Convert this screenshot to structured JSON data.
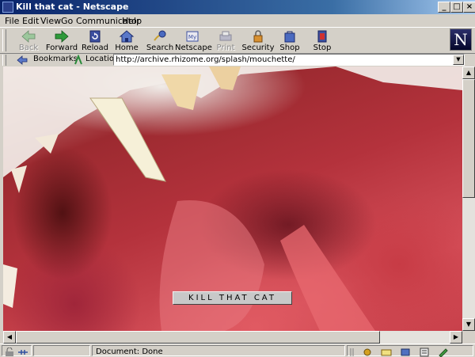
{
  "window": {
    "title": "Kill that cat - Netscape"
  },
  "menu": {
    "items": [
      "File",
      "Edit",
      "View",
      "Go",
      "Communicator",
      "Help"
    ]
  },
  "toolbar": {
    "buttons": [
      {
        "label": "Back",
        "icon": "back-arrow-icon",
        "enabled": false
      },
      {
        "label": "Forward",
        "icon": "forward-arrow-icon",
        "enabled": true
      },
      {
        "label": "Reload",
        "icon": "reload-icon",
        "enabled": true
      },
      {
        "label": "Home",
        "icon": "home-icon",
        "enabled": true
      },
      {
        "label": "Search",
        "icon": "search-icon",
        "enabled": true
      },
      {
        "label": "Netscape",
        "icon": "netscape-icon",
        "enabled": true
      },
      {
        "label": "Print",
        "icon": "print-icon",
        "enabled": false
      },
      {
        "label": "Security",
        "icon": "lock-icon",
        "enabled": true
      },
      {
        "label": "Shop",
        "icon": "shop-icon",
        "enabled": true
      },
      {
        "label": "Stop",
        "icon": "stop-icon",
        "enabled": true
      }
    ],
    "logo_letter": "N"
  },
  "location": {
    "bookmarks_label": "Bookmarks",
    "location_label": "Location:",
    "url": "http://archive.rhizome.org/splash/mouchette/"
  },
  "page": {
    "button_label": "KILL THAT CAT"
  },
  "status": {
    "text": "Document: Done"
  },
  "colors": {
    "title_start": "#0a246a",
    "title_end": "#a6caf0",
    "chrome": "#d4d0c8"
  }
}
